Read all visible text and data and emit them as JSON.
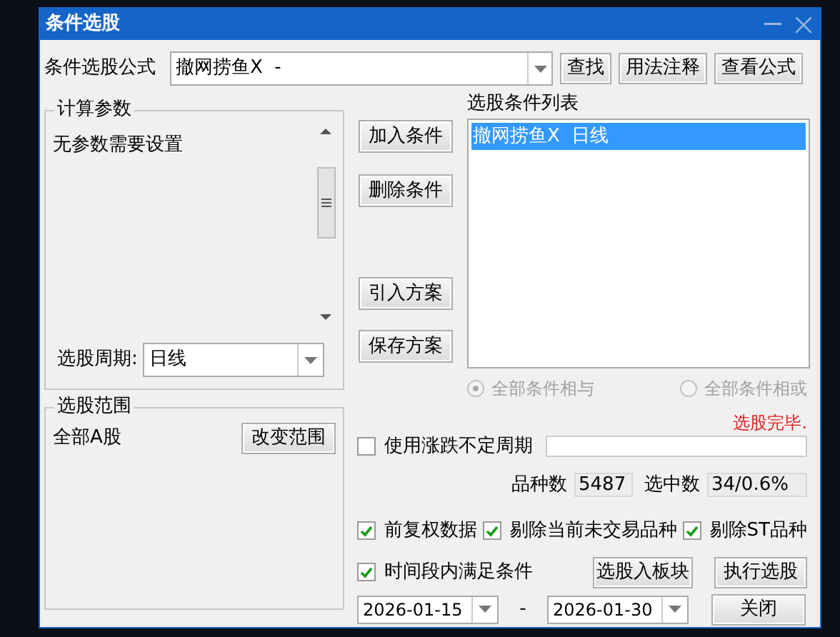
{
  "window": {
    "title": "条件选股"
  },
  "formula": {
    "label": "条件选股公式",
    "value": "撤网捞鱼X  -",
    "buttons": [
      "查找",
      "用法注释",
      "查看公式"
    ]
  },
  "params": {
    "title": "计算参数",
    "message": "无参数需要设置",
    "period_label": "选股周期:",
    "period_value": "日线"
  },
  "actions": [
    "加入条件",
    "删除条件",
    "引入方案",
    "保存方案"
  ],
  "conditions": {
    "title": "选股条件列表",
    "items": [
      {
        "text": "撤网捞鱼X  日线",
        "selected": true
      }
    ]
  },
  "logic": [
    {
      "label": "全部条件相与",
      "selected": true,
      "disabled": true
    },
    {
      "label": "全部条件相或",
      "selected": false,
      "disabled": true
    }
  ],
  "status": "选股完毕.",
  "scope": {
    "title": "选股范围",
    "value": "全部A股",
    "button": "改变范围"
  },
  "variable_period": {
    "label": "使用涨跌不定周期",
    "checked": false
  },
  "counts": [
    {
      "label": "品种数",
      "value": "5487"
    },
    {
      "label": "选中数",
      "value": "34/0.6%"
    }
  ],
  "options": [
    {
      "label": "前复权数据",
      "checked": true
    },
    {
      "label": "剔除当前未交易品种",
      "checked": true
    },
    {
      "label": "剔除ST品种",
      "checked": true
    }
  ],
  "time_range": {
    "label": "时间段内满足条件",
    "checked": true,
    "start": "2026-01-15",
    "separator": "-",
    "end": "2026-01-30"
  },
  "bottom_buttons": [
    "选股入板块",
    "执行选股",
    "关闭"
  ]
}
